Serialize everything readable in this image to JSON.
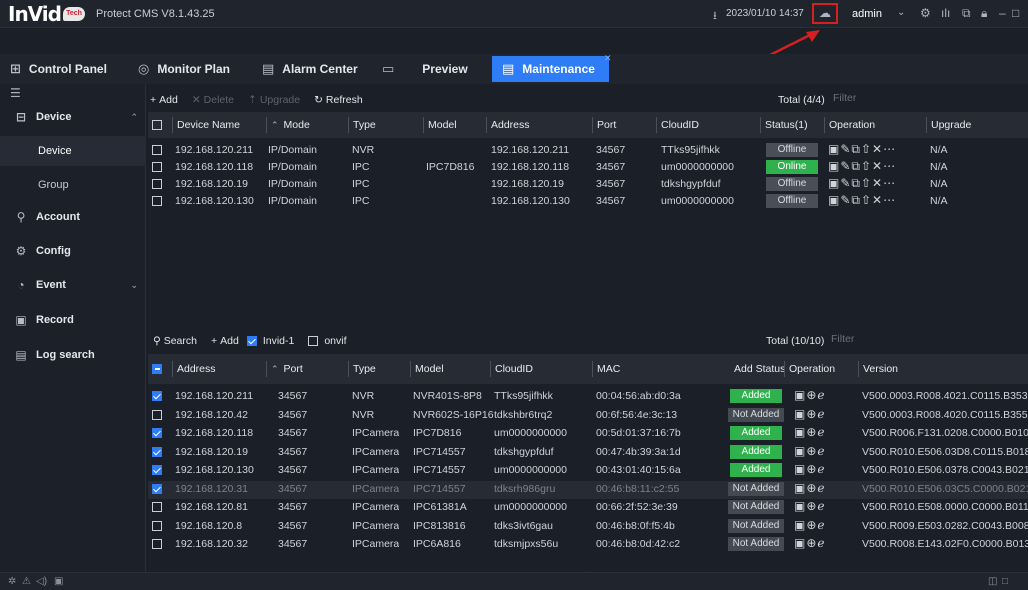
{
  "app": {
    "logo_text": "InVid",
    "logo_badge": "Tech",
    "version": "Protect CMS V8.1.43.25",
    "datetime": "2023/01/10 14:37",
    "user": "admin"
  },
  "icons": {
    "download": "download-icon",
    "cloud": "cloud-icon",
    "settings": "gear-icon",
    "stats": "bars-icon",
    "screenshot": "screen-icon",
    "lock": "lock-icon",
    "minimize": "minimize-icon",
    "maximize": "maximize-icon",
    "close": "close-icon"
  },
  "colors": {
    "accent": "#2e7cf6",
    "online": "#2fb24d",
    "annotation": "#d42020"
  },
  "tabs": [
    {
      "label": "Control Panel",
      "icon": "grid-icon"
    },
    {
      "label": "Monitor Plan",
      "icon": "monitor-plan-icon"
    },
    {
      "label": "Alarm Center",
      "icon": "alarm-icon"
    },
    {
      "label": "Preview",
      "icon": "monitor-icon"
    },
    {
      "label": "Maintenance",
      "icon": "maintenance-icon",
      "active": true
    }
  ],
  "sidebar": {
    "items": [
      {
        "label": "Device",
        "icon": "device-icon",
        "expanded": true
      },
      {
        "label": "Device",
        "sub": true,
        "active": true
      },
      {
        "label": "Group",
        "sub": true
      },
      {
        "label": "Account",
        "icon": "account-icon"
      },
      {
        "label": "Config",
        "icon": "config-icon"
      },
      {
        "label": "Event",
        "icon": "event-icon",
        "expandable": true
      },
      {
        "label": "Record",
        "icon": "record-icon"
      },
      {
        "label": "Log search",
        "icon": "log-icon"
      }
    ]
  },
  "device_toolbar": {
    "add": "Add",
    "delete": "Delete",
    "upgrade": "Upgrade",
    "refresh": "Refresh",
    "total": "Total (4/4)",
    "filter_placeholder": "Filter"
  },
  "device_table": {
    "headers": [
      "Device Name",
      "Mode",
      "Type",
      "Model",
      "Address",
      "Port",
      "CloudID",
      "Status(1)",
      "Operation",
      "Upgrade"
    ],
    "rows": [
      {
        "name": "192.168.120.211",
        "mode": "IP/Domain",
        "type": "NVR",
        "model": "",
        "address": "192.168.120.211",
        "port": "34567",
        "cloudid": "TTks95jifhkk",
        "status": "Offline",
        "online": false,
        "upgrade": "N/A"
      },
      {
        "name": "192.168.120.118",
        "mode": "IP/Domain",
        "type": "IPC",
        "model": "IPC7D816",
        "address": "192.168.120.118",
        "port": "34567",
        "cloudid": "um0000000000",
        "status": "Online",
        "online": true,
        "upgrade": "N/A"
      },
      {
        "name": "192.168.120.19",
        "mode": "IP/Domain",
        "type": "IPC",
        "model": "",
        "address": "192.168.120.19",
        "port": "34567",
        "cloudid": "tdkshgypfduf",
        "status": "Offline",
        "online": false,
        "upgrade": "N/A"
      },
      {
        "name": "192.168.120.130",
        "mode": "IP/Domain",
        "type": "IPC",
        "model": "",
        "address": "192.168.120.130",
        "port": "34567",
        "cloudid": "um0000000000",
        "status": "Offline",
        "online": false,
        "upgrade": "N/A"
      }
    ]
  },
  "search_toolbar": {
    "search": "Search",
    "add": "Add",
    "invid_filter": "Invid-1",
    "onvif_filter": "onvif",
    "total": "Total (10/10)",
    "filter_placeholder": "Filter"
  },
  "search_table": {
    "headers": [
      "Address",
      "Port",
      "Type",
      "Model",
      "CloudID",
      "MAC",
      "Add Status",
      "Operation",
      "Version"
    ],
    "rows": [
      {
        "checked": true,
        "address": "192.168.120.211",
        "port": "34567",
        "type": "NVR",
        "model": "NVR401S-8P8",
        "cloudid": "TTks95jifhkk",
        "mac": "00:04:56:ab:d0:3a",
        "status": "Added",
        "added": true,
        "version": "V500.0003.R008.4021.C0115.B353."
      },
      {
        "checked": false,
        "address": "192.168.120.42",
        "port": "34567",
        "type": "NVR",
        "model": "NVR602S-16P16",
        "cloudid": "tdkshbr6trq2",
        "mac": "00:6f:56:4e:3c:13",
        "status": "Not Added",
        "added": false,
        "version": "V500.0003.R008.4020.C0115.B355."
      },
      {
        "checked": true,
        "address": "192.168.120.118",
        "port": "34567",
        "type": "IPCamera",
        "model": "IPC7D816",
        "cloudid": "um0000000000",
        "mac": "00:5d:01:37:16:7b",
        "status": "Added",
        "added": true,
        "version": "V500.R006.F131.0208.C0000.B010"
      },
      {
        "checked": true,
        "address": "192.168.120.19",
        "port": "34567",
        "type": "IPCamera",
        "model": "IPC714557",
        "cloudid": "tdkshgypfduf",
        "mac": "00:47:4b:39:3a:1d",
        "status": "Added",
        "added": true,
        "version": "V500.R010.E506.03D8.C0115.B018"
      },
      {
        "checked": true,
        "address": "192.168.120.130",
        "port": "34567",
        "type": "IPCamera",
        "model": "IPC714557",
        "cloudid": "um0000000000",
        "mac": "00:43:01:40:15:6a",
        "status": "Added",
        "added": true,
        "version": "V500.R010.E506.0378.C0043.B021"
      },
      {
        "checked": true,
        "dim": true,
        "address": "192.168.120.31",
        "port": "34567",
        "type": "IPCamera",
        "model": "IPC714557",
        "cloudid": "tdksrh986gru",
        "mac": "00:46:b8:11:c2:55",
        "status": "Not Added",
        "added": false,
        "version": "V500.R010.E506.03C5.C0000.B021"
      },
      {
        "checked": false,
        "address": "192.168.120.81",
        "port": "34567",
        "type": "IPCamera",
        "model": "IPC61381A",
        "cloudid": "um0000000000",
        "mac": "00:66:2f:52:3e:39",
        "status": "Not Added",
        "added": false,
        "version": "V500.R010.E508.0000.C0000.B011"
      },
      {
        "checked": false,
        "address": "192.168.120.8",
        "port": "34567",
        "type": "IPCamera",
        "model": "IPC813816",
        "cloudid": "tdks3ivt6gau",
        "mac": "00:46:b8:0f:f5:4b",
        "status": "Not Added",
        "added": false,
        "version": "V500.R009.E503.0282.C0043.B008"
      },
      {
        "checked": false,
        "address": "192.168.120.32",
        "port": "34567",
        "type": "IPCamera",
        "model": "IPC6A816",
        "cloudid": "tdksmjpxs56u",
        "mac": "00:46:b8:0d:42:c2",
        "status": "Not Added",
        "added": false,
        "version": "V500.R008.E143.02F0.C0000.B013"
      }
    ]
  }
}
